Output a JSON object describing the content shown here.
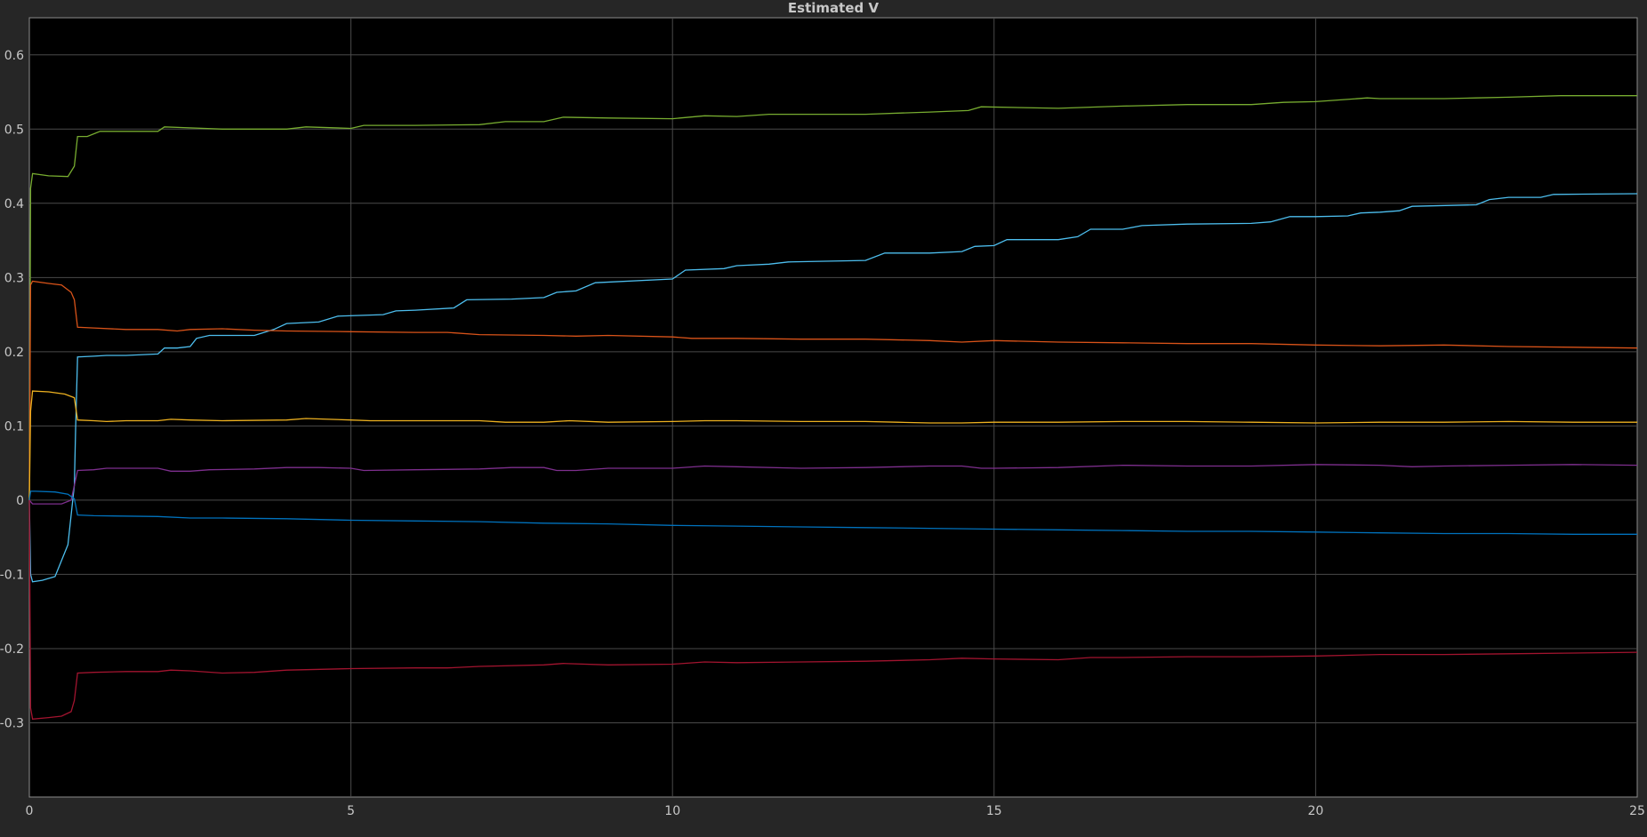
{
  "chart_data": {
    "type": "line",
    "title": "Estimated V",
    "xlabel": "",
    "ylabel": "",
    "xlim": [
      0,
      25
    ],
    "ylim": [
      -0.4,
      0.65
    ],
    "xticks": [
      0,
      5,
      10,
      15,
      20,
      25
    ],
    "yticks": [
      -0.3,
      -0.2,
      -0.1,
      0,
      0.1,
      0.2,
      0.3,
      0.4,
      0.5,
      0.6
    ],
    "grid": true,
    "background": "#000000",
    "series": [
      {
        "color": "#77ac30",
        "points": [
          [
            0,
            0
          ],
          [
            0.02,
            0.42
          ],
          [
            0.05,
            0.44
          ],
          [
            0.3,
            0.437
          ],
          [
            0.6,
            0.436
          ],
          [
            0.7,
            0.45
          ],
          [
            0.75,
            0.49
          ],
          [
            0.9,
            0.49
          ],
          [
            1.1,
            0.497
          ],
          [
            2,
            0.497
          ],
          [
            2.1,
            0.503
          ],
          [
            2.4,
            0.502
          ],
          [
            3,
            0.5
          ],
          [
            4,
            0.5
          ],
          [
            4.3,
            0.503
          ],
          [
            5,
            0.501
          ],
          [
            5.2,
            0.505
          ],
          [
            6,
            0.505
          ],
          [
            7,
            0.506
          ],
          [
            7.4,
            0.51
          ],
          [
            8,
            0.51
          ],
          [
            8.3,
            0.516
          ],
          [
            9,
            0.515
          ],
          [
            10,
            0.514
          ],
          [
            10.5,
            0.518
          ],
          [
            11,
            0.517
          ],
          [
            11.5,
            0.52
          ],
          [
            13,
            0.52
          ],
          [
            14,
            0.523
          ],
          [
            14.6,
            0.525
          ],
          [
            14.8,
            0.53
          ],
          [
            16,
            0.528
          ],
          [
            17,
            0.531
          ],
          [
            18,
            0.533
          ],
          [
            19,
            0.533
          ],
          [
            19.5,
            0.536
          ],
          [
            20,
            0.537
          ],
          [
            20.8,
            0.542
          ],
          [
            21,
            0.541
          ],
          [
            22,
            0.541
          ],
          [
            22.5,
            0.542
          ],
          [
            23,
            0.543
          ],
          [
            23.8,
            0.545
          ],
          [
            25,
            0.545
          ]
        ]
      },
      {
        "color": "#4dbeee",
        "points": [
          [
            0,
            0
          ],
          [
            0.02,
            -0.1
          ],
          [
            0.05,
            -0.11
          ],
          [
            0.2,
            -0.108
          ],
          [
            0.4,
            -0.103
          ],
          [
            0.6,
            -0.06
          ],
          [
            0.7,
            0.02
          ],
          [
            0.72,
            0.1
          ],
          [
            0.75,
            0.193
          ],
          [
            1,
            0.194
          ],
          [
            1.2,
            0.195
          ],
          [
            1.5,
            0.195
          ],
          [
            2,
            0.197
          ],
          [
            2.1,
            0.205
          ],
          [
            2.3,
            0.205
          ],
          [
            2.5,
            0.207
          ],
          [
            2.6,
            0.218
          ],
          [
            2.8,
            0.222
          ],
          [
            3.5,
            0.222
          ],
          [
            3.8,
            0.23
          ],
          [
            4,
            0.238
          ],
          [
            4.5,
            0.24
          ],
          [
            4.8,
            0.248
          ],
          [
            5.5,
            0.25
          ],
          [
            5.7,
            0.255
          ],
          [
            6,
            0.256
          ],
          [
            6.6,
            0.259
          ],
          [
            6.8,
            0.27
          ],
          [
            7.5,
            0.271
          ],
          [
            8,
            0.273
          ],
          [
            8.2,
            0.28
          ],
          [
            8.5,
            0.282
          ],
          [
            8.8,
            0.293
          ],
          [
            10,
            0.298
          ],
          [
            10.2,
            0.31
          ],
          [
            10.8,
            0.312
          ],
          [
            11,
            0.316
          ],
          [
            11.5,
            0.318
          ],
          [
            11.8,
            0.321
          ],
          [
            13,
            0.323
          ],
          [
            13.3,
            0.333
          ],
          [
            14,
            0.333
          ],
          [
            14.5,
            0.335
          ],
          [
            14.7,
            0.342
          ],
          [
            15,
            0.343
          ],
          [
            15.2,
            0.351
          ],
          [
            16,
            0.351
          ],
          [
            16.3,
            0.355
          ],
          [
            16.5,
            0.365
          ],
          [
            17,
            0.365
          ],
          [
            17.3,
            0.37
          ],
          [
            18,
            0.372
          ],
          [
            19,
            0.373
          ],
          [
            19.3,
            0.375
          ],
          [
            19.6,
            0.382
          ],
          [
            20,
            0.382
          ],
          [
            20.5,
            0.383
          ],
          [
            20.7,
            0.387
          ],
          [
            21,
            0.388
          ],
          [
            21.3,
            0.39
          ],
          [
            21.5,
            0.396
          ],
          [
            22.5,
            0.398
          ],
          [
            22.7,
            0.405
          ],
          [
            23,
            0.408
          ],
          [
            23.5,
            0.408
          ],
          [
            23.7,
            0.412
          ],
          [
            25,
            0.413
          ]
        ]
      },
      {
        "color": "#d95319",
        "points": [
          [
            0,
            0
          ],
          [
            0.02,
            0.29
          ],
          [
            0.05,
            0.295
          ],
          [
            0.3,
            0.292
          ],
          [
            0.5,
            0.29
          ],
          [
            0.65,
            0.28
          ],
          [
            0.7,
            0.27
          ],
          [
            0.75,
            0.233
          ],
          [
            1,
            0.232
          ],
          [
            1.5,
            0.23
          ],
          [
            2,
            0.23
          ],
          [
            2.3,
            0.228
          ],
          [
            2.5,
            0.23
          ],
          [
            3,
            0.231
          ],
          [
            3.5,
            0.229
          ],
          [
            4,
            0.228
          ],
          [
            5,
            0.227
          ],
          [
            6,
            0.226
          ],
          [
            6.5,
            0.226
          ],
          [
            7,
            0.223
          ],
          [
            8,
            0.222
          ],
          [
            8.5,
            0.221
          ],
          [
            9,
            0.222
          ],
          [
            10,
            0.22
          ],
          [
            10.3,
            0.218
          ],
          [
            11,
            0.218
          ],
          [
            12,
            0.217
          ],
          [
            13,
            0.217
          ],
          [
            14,
            0.215
          ],
          [
            14.5,
            0.213
          ],
          [
            15,
            0.215
          ],
          [
            16,
            0.213
          ],
          [
            17,
            0.212
          ],
          [
            18,
            0.211
          ],
          [
            19,
            0.211
          ],
          [
            20,
            0.209
          ],
          [
            21,
            0.208
          ],
          [
            22,
            0.209
          ],
          [
            23,
            0.207
          ],
          [
            24,
            0.206
          ],
          [
            25,
            0.205
          ]
        ]
      },
      {
        "color": "#edb120",
        "points": [
          [
            0,
            0
          ],
          [
            0.02,
            0.12
          ],
          [
            0.05,
            0.147
          ],
          [
            0.3,
            0.146
          ],
          [
            0.55,
            0.143
          ],
          [
            0.7,
            0.138
          ],
          [
            0.75,
            0.108
          ],
          [
            1,
            0.107
          ],
          [
            1.2,
            0.106
          ],
          [
            1.5,
            0.107
          ],
          [
            2,
            0.107
          ],
          [
            2.2,
            0.109
          ],
          [
            2.5,
            0.108
          ],
          [
            3,
            0.107
          ],
          [
            4,
            0.108
          ],
          [
            4.3,
            0.11
          ],
          [
            5,
            0.108
          ],
          [
            5.3,
            0.107
          ],
          [
            6,
            0.107
          ],
          [
            7,
            0.107
          ],
          [
            7.4,
            0.105
          ],
          [
            8,
            0.105
          ],
          [
            8.4,
            0.107
          ],
          [
            9,
            0.105
          ],
          [
            10,
            0.106
          ],
          [
            10.5,
            0.107
          ],
          [
            11,
            0.107
          ],
          [
            12,
            0.106
          ],
          [
            13,
            0.106
          ],
          [
            13.5,
            0.105
          ],
          [
            14,
            0.104
          ],
          [
            14.5,
            0.104
          ],
          [
            15,
            0.105
          ],
          [
            16,
            0.105
          ],
          [
            17,
            0.106
          ],
          [
            18,
            0.106
          ],
          [
            19,
            0.105
          ],
          [
            20,
            0.104
          ],
          [
            21,
            0.105
          ],
          [
            22,
            0.105
          ],
          [
            23,
            0.106
          ],
          [
            24,
            0.105
          ],
          [
            25,
            0.105
          ]
        ]
      },
      {
        "color": "#7e2f8e",
        "points": [
          [
            0,
            0
          ],
          [
            0.05,
            -0.005
          ],
          [
            0.5,
            -0.005
          ],
          [
            0.65,
            0
          ],
          [
            0.7,
            0.02
          ],
          [
            0.75,
            0.04
          ],
          [
            1,
            0.041
          ],
          [
            1.2,
            0.043
          ],
          [
            2,
            0.043
          ],
          [
            2.2,
            0.039
          ],
          [
            2.5,
            0.039
          ],
          [
            2.8,
            0.041
          ],
          [
            3.5,
            0.042
          ],
          [
            4,
            0.044
          ],
          [
            4.5,
            0.044
          ],
          [
            5,
            0.043
          ],
          [
            5.2,
            0.04
          ],
          [
            6,
            0.041
          ],
          [
            7,
            0.042
          ],
          [
            7.5,
            0.044
          ],
          [
            8,
            0.044
          ],
          [
            8.2,
            0.04
          ],
          [
            8.5,
            0.04
          ],
          [
            9,
            0.043
          ],
          [
            10,
            0.043
          ],
          [
            10.5,
            0.046
          ],
          [
            11,
            0.045
          ],
          [
            12,
            0.043
          ],
          [
            13,
            0.044
          ],
          [
            14,
            0.046
          ],
          [
            14.5,
            0.046
          ],
          [
            14.8,
            0.043
          ],
          [
            15,
            0.043
          ],
          [
            16,
            0.044
          ],
          [
            17,
            0.047
          ],
          [
            18,
            0.046
          ],
          [
            19,
            0.046
          ],
          [
            20,
            0.048
          ],
          [
            21,
            0.047
          ],
          [
            21.5,
            0.045
          ],
          [
            22,
            0.046
          ],
          [
            23,
            0.047
          ],
          [
            24,
            0.048
          ],
          [
            25,
            0.047
          ]
        ]
      },
      {
        "color": "#0072bd",
        "points": [
          [
            0,
            0
          ],
          [
            0.02,
            0.012
          ],
          [
            0.1,
            0.012
          ],
          [
            0.4,
            0.011
          ],
          [
            0.6,
            0.008
          ],
          [
            0.7,
            0.002
          ],
          [
            0.75,
            -0.02
          ],
          [
            1,
            -0.021
          ],
          [
            2,
            -0.022
          ],
          [
            2.5,
            -0.024
          ],
          [
            3,
            -0.024
          ],
          [
            4,
            -0.025
          ],
          [
            5,
            -0.027
          ],
          [
            6,
            -0.028
          ],
          [
            7,
            -0.029
          ],
          [
            8,
            -0.031
          ],
          [
            9,
            -0.032
          ],
          [
            10,
            -0.034
          ],
          [
            11,
            -0.035
          ],
          [
            12,
            -0.036
          ],
          [
            13,
            -0.037
          ],
          [
            14,
            -0.038
          ],
          [
            15,
            -0.039
          ],
          [
            16,
            -0.04
          ],
          [
            17,
            -0.041
          ],
          [
            18,
            -0.042
          ],
          [
            19,
            -0.042
          ],
          [
            20,
            -0.043
          ],
          [
            21,
            -0.044
          ],
          [
            22,
            -0.045
          ],
          [
            23,
            -0.045
          ],
          [
            24,
            -0.046
          ],
          [
            25,
            -0.046
          ]
        ]
      },
      {
        "color": "#a2142f",
        "points": [
          [
            0,
            0
          ],
          [
            0.02,
            -0.28
          ],
          [
            0.05,
            -0.295
          ],
          [
            0.3,
            -0.293
          ],
          [
            0.5,
            -0.291
          ],
          [
            0.65,
            -0.285
          ],
          [
            0.7,
            -0.27
          ],
          [
            0.75,
            -0.233
          ],
          [
            1,
            -0.232
          ],
          [
            1.5,
            -0.231
          ],
          [
            2,
            -0.231
          ],
          [
            2.2,
            -0.229
          ],
          [
            2.5,
            -0.23
          ],
          [
            3,
            -0.233
          ],
          [
            3.5,
            -0.232
          ],
          [
            4,
            -0.229
          ],
          [
            5,
            -0.227
          ],
          [
            6,
            -0.226
          ],
          [
            6.5,
            -0.226
          ],
          [
            7,
            -0.224
          ],
          [
            8,
            -0.222
          ],
          [
            8.3,
            -0.22
          ],
          [
            9,
            -0.222
          ],
          [
            10,
            -0.221
          ],
          [
            10.5,
            -0.218
          ],
          [
            11,
            -0.219
          ],
          [
            12,
            -0.218
          ],
          [
            13,
            -0.217
          ],
          [
            14,
            -0.215
          ],
          [
            14.5,
            -0.213
          ],
          [
            15,
            -0.214
          ],
          [
            16,
            -0.215
          ],
          [
            16.5,
            -0.212
          ],
          [
            17,
            -0.212
          ],
          [
            18,
            -0.211
          ],
          [
            19,
            -0.211
          ],
          [
            20,
            -0.21
          ],
          [
            21,
            -0.208
          ],
          [
            22,
            -0.208
          ],
          [
            23,
            -0.207
          ],
          [
            24,
            -0.206
          ],
          [
            25,
            -0.205
          ]
        ]
      }
    ]
  }
}
